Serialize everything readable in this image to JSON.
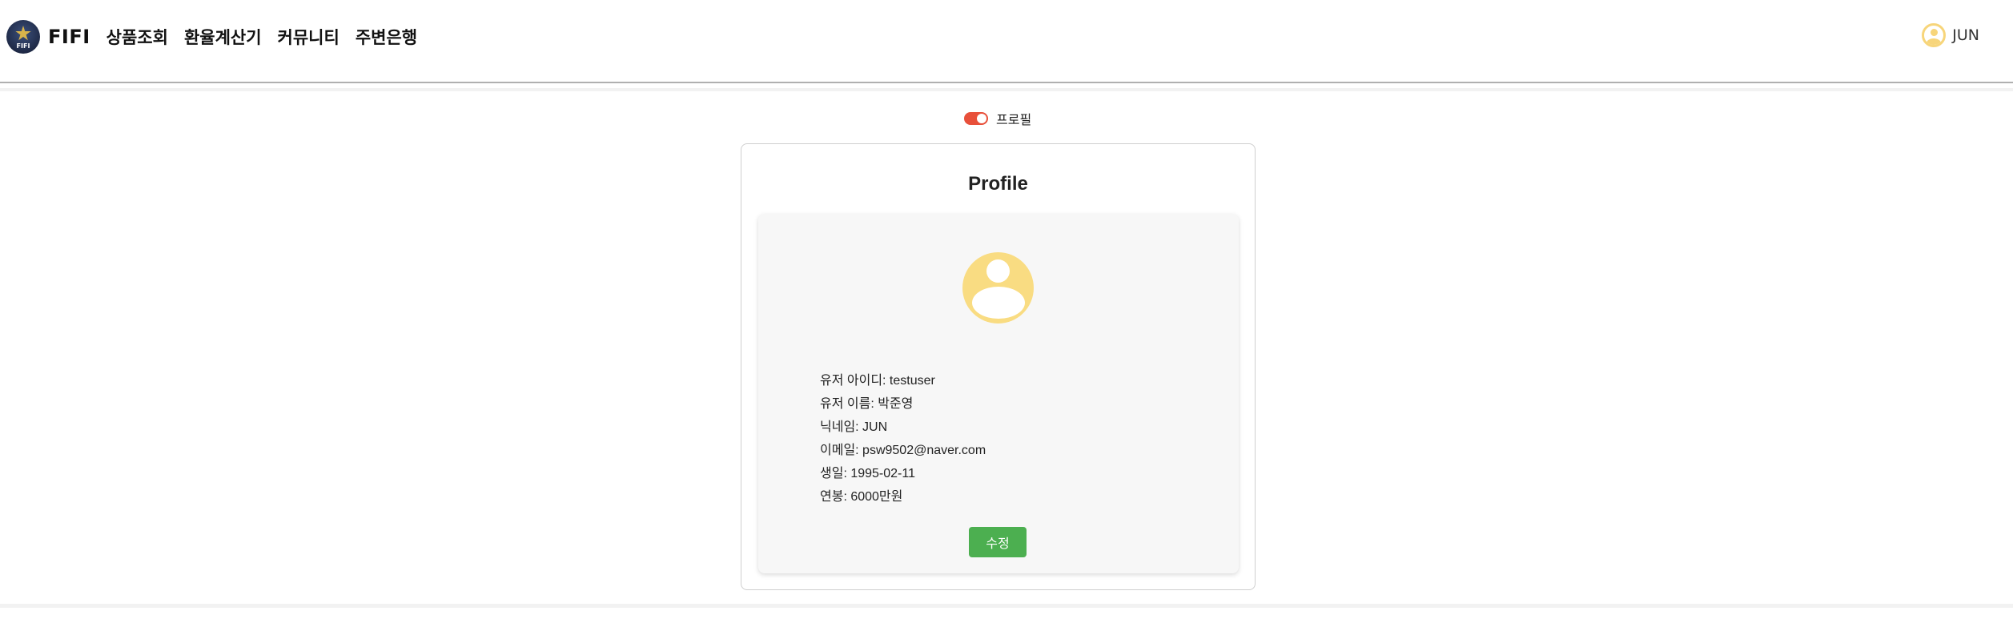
{
  "header": {
    "logo_text": "FIFI",
    "brand": "FIFI",
    "nav": [
      {
        "label": "상품조회"
      },
      {
        "label": "환율계산기"
      },
      {
        "label": "커뮤니티"
      },
      {
        "label": "주변은행"
      }
    ],
    "user": {
      "name": "JUN",
      "icon": "user-circle-icon"
    }
  },
  "toggle": {
    "label": "프로필",
    "state": "on",
    "color": "#e8503a"
  },
  "profile": {
    "title": "Profile",
    "avatar_icon": "user-avatar-icon",
    "avatar_color": "#f9dc82",
    "fields": [
      {
        "text": "유저 아이디: testuser"
      },
      {
        "text": "유저 이름: 박준영"
      },
      {
        "text": "닉네임: JUN"
      },
      {
        "text": "이메일: psw9502@naver.com"
      },
      {
        "text": "생일: 1995-02-11"
      },
      {
        "text": "연봉: 6000만원"
      }
    ],
    "edit_label": "수정",
    "edit_color": "#4caf50"
  }
}
